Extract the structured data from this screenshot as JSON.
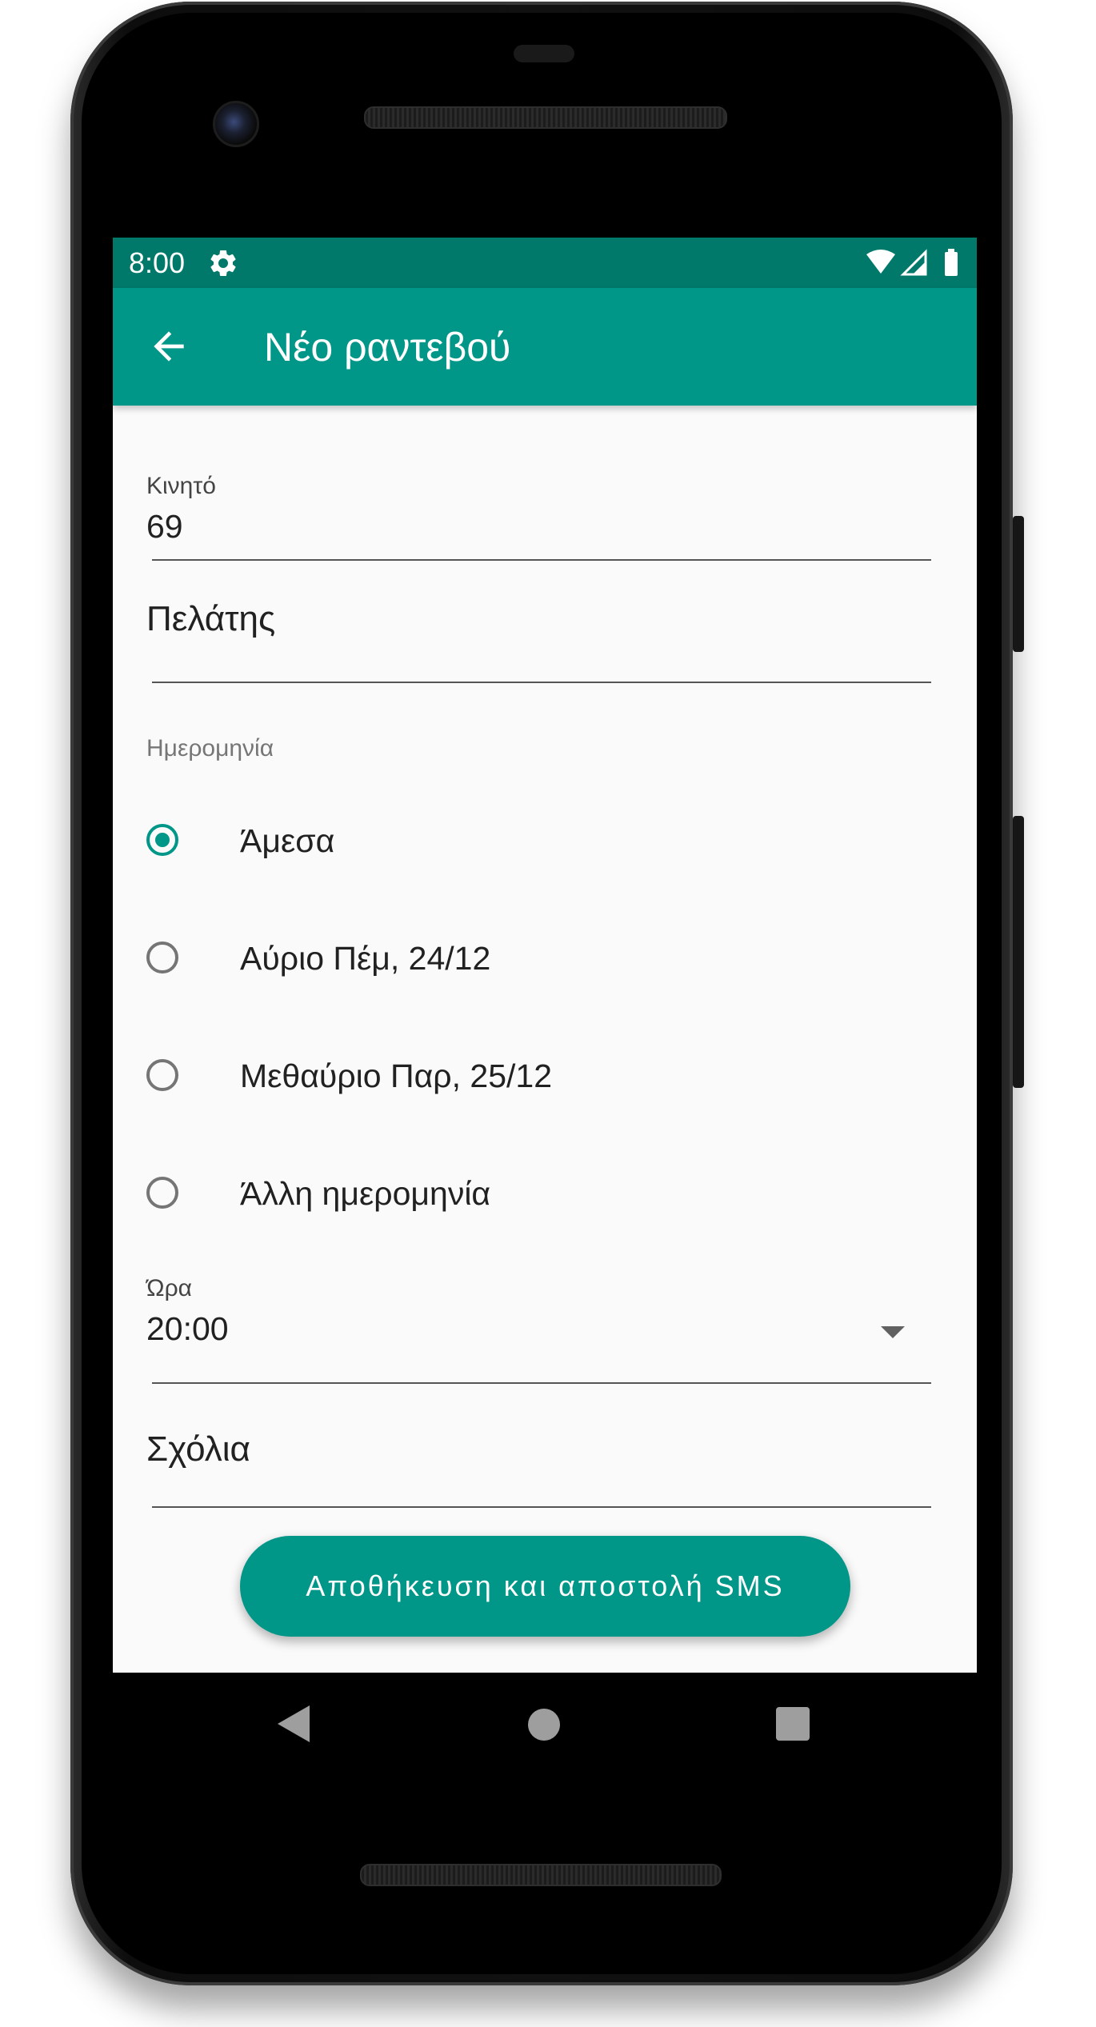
{
  "status_bar": {
    "time": "8:00"
  },
  "app_bar": {
    "title": "Νέο ραντεβού"
  },
  "form": {
    "mobile": {
      "label": "Κινητό",
      "value": "69"
    },
    "customer": {
      "placeholder": "Πελάτης"
    },
    "date": {
      "label": "Ημερομηνία",
      "options": [
        {
          "label": "Άμεσα",
          "checked": true
        },
        {
          "label": "Αύριο Πέμ, 24/12",
          "checked": false
        },
        {
          "label": "Μεθαύριο Παρ, 25/12",
          "checked": false
        },
        {
          "label": "Άλλη ημερομηνία",
          "checked": false
        }
      ]
    },
    "time": {
      "label": "Ώρα",
      "value": "20:00"
    },
    "comments": {
      "placeholder": "Σχόλια"
    },
    "submit_label": "Αποθήκευση και αποστολή SMS"
  },
  "colors": {
    "primary": "#009688",
    "primary_dark": "#00796b",
    "background": "#fafafa"
  },
  "icons": {
    "status": [
      "gear-icon",
      "wifi-icon",
      "signal-icon",
      "battery-icon"
    ],
    "app_bar": "back-arrow-icon",
    "navigation": [
      "nav-back-icon",
      "nav-home-icon",
      "nav-recents-icon"
    ]
  }
}
